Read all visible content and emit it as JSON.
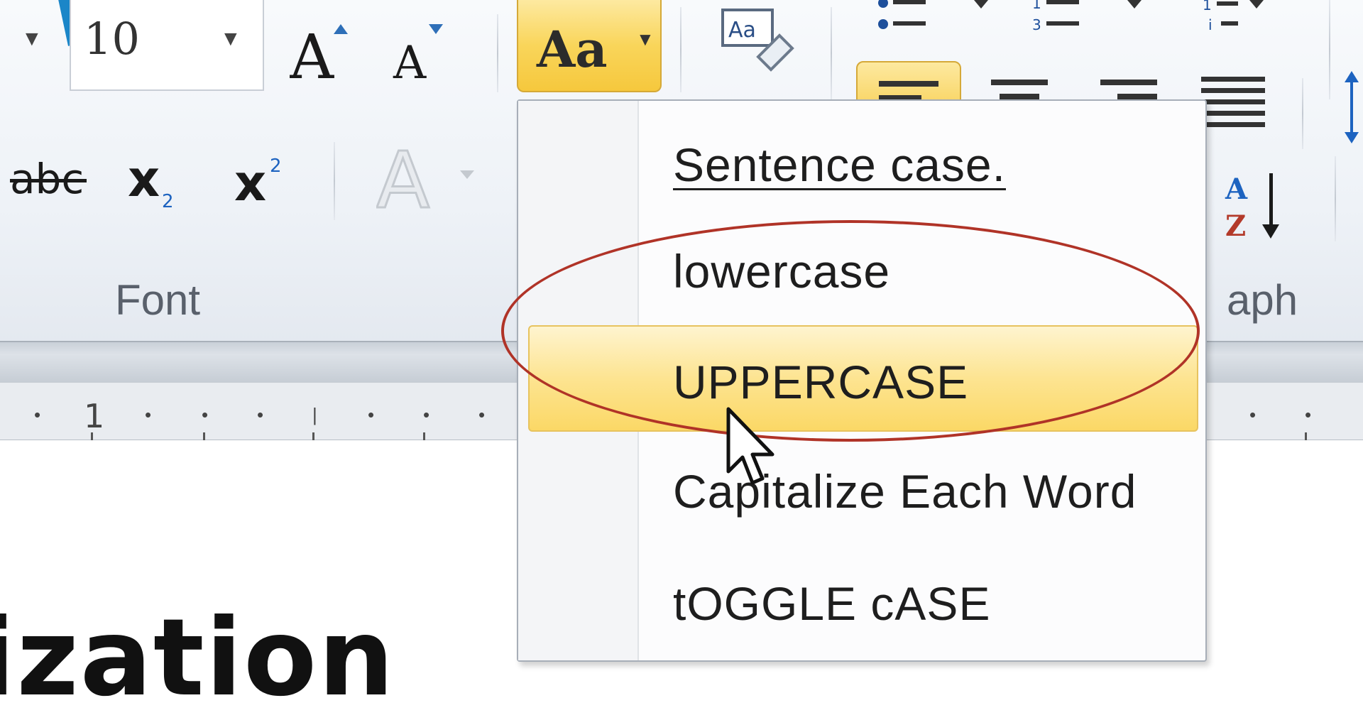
{
  "ribbon": {
    "font_size": {
      "value": "10"
    },
    "font_group_label": "Font",
    "paragraph_group_label": "aph",
    "change_case_button_label": "Aa"
  },
  "ruler": {
    "digit": "1"
  },
  "change_case_menu": {
    "items": [
      {
        "label": "Sentence case.",
        "hovered": false
      },
      {
        "label": "lowercase",
        "hovered": false
      },
      {
        "label": "UPPERCASE",
        "hovered": true
      },
      {
        "label": "Capitalize Each Word",
        "hovered": false
      },
      {
        "label": "tOGGLE cASE",
        "hovered": false
      }
    ]
  },
  "document": {
    "visible_text": "ization"
  },
  "annotation": {
    "color": "#b03327",
    "target": "UPPERCASE"
  },
  "colors": {
    "highlight": "#f9d55a",
    "menu_hover": "#fde491"
  }
}
